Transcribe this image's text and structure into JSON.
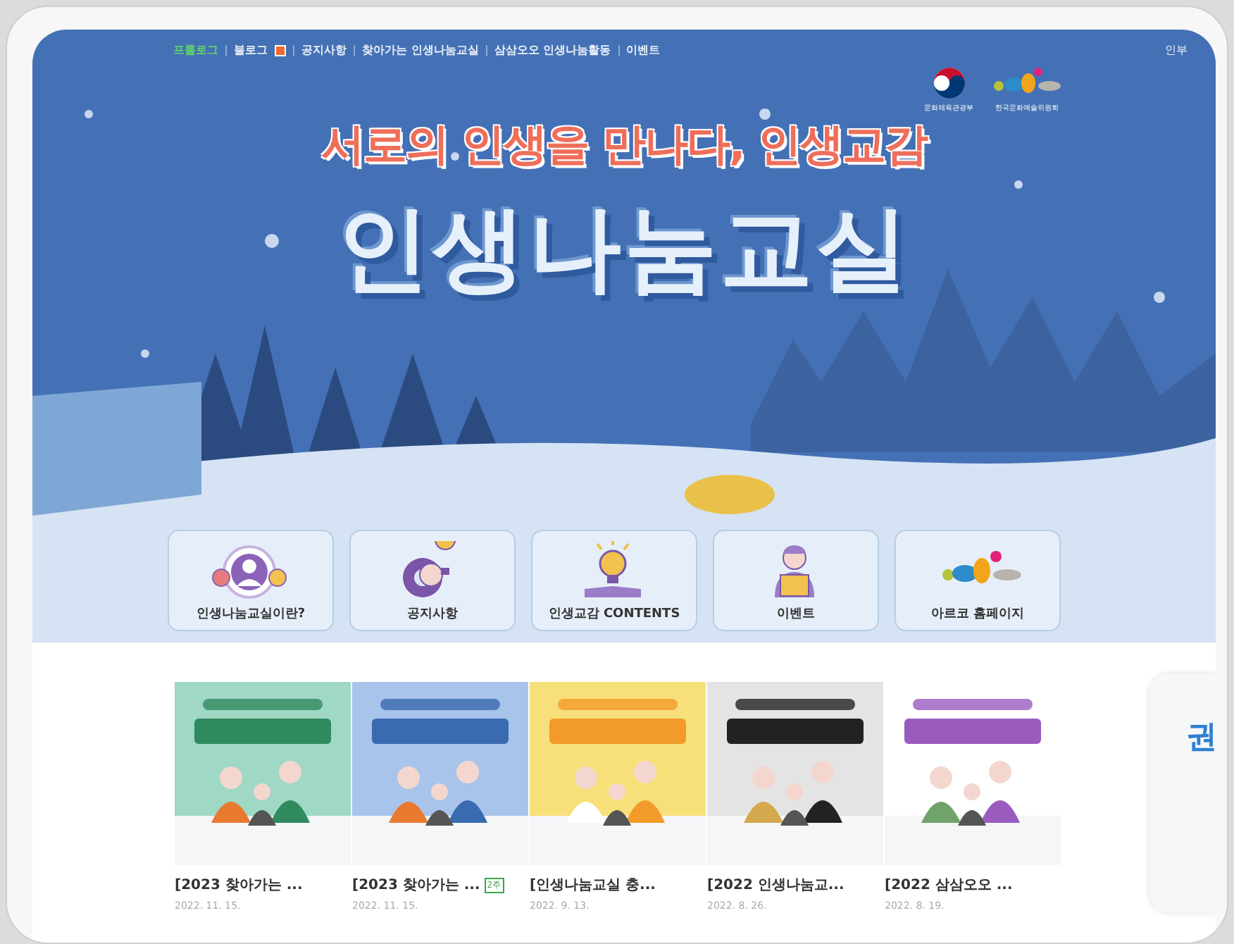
{
  "nav": {
    "items": [
      {
        "label": "프롤로그",
        "selected": true,
        "kind": "link"
      },
      {
        "label": "블로그",
        "selected": false,
        "kind": "blog"
      },
      {
        "label": "공지사항",
        "selected": false,
        "kind": "link"
      },
      {
        "label": "찾아가는 인생나눔교실",
        "selected": false,
        "kind": "link"
      },
      {
        "label": "삼삼오오 인생나눔활동",
        "selected": false,
        "kind": "link"
      },
      {
        "label": "이벤트",
        "selected": false,
        "kind": "link"
      }
    ],
    "utility_link": "인부"
  },
  "logos": [
    {
      "caption": "문화체육관광부",
      "kind": "ministry"
    },
    {
      "caption": "한국문화예술위원회",
      "kind": "arko"
    }
  ],
  "hero": {
    "subtitle": "서로의 인생을 만나다, 인생교감",
    "title": "인생나눔교실"
  },
  "quick_links": [
    {
      "label": "인생나눔교실이란?",
      "kind": "people"
    },
    {
      "label": "공지사항",
      "kind": "gear"
    },
    {
      "label": "인생교감 CONTENTS",
      "kind": "bulb"
    },
    {
      "label": "이벤트",
      "kind": "person"
    },
    {
      "label": "아르코 홈페이지",
      "kind": "dots"
    }
  ],
  "posts": [
    {
      "title": "[2023 찾아가는 ...",
      "date": "2022. 11. 15."
    },
    {
      "title": "[2023 찾아가는 ...",
      "date": "2022. 11. 15.",
      "badge": "2주"
    },
    {
      "title": "[인생나눔교실 충...",
      "date": "2022. 9. 13."
    },
    {
      "title": "[2022 인생나눔교...",
      "date": "2022. 8. 26."
    },
    {
      "title": "[2022 삼삼오오 ...",
      "date": "2022. 8. 19."
    }
  ],
  "side_card": {
    "text": "권"
  }
}
